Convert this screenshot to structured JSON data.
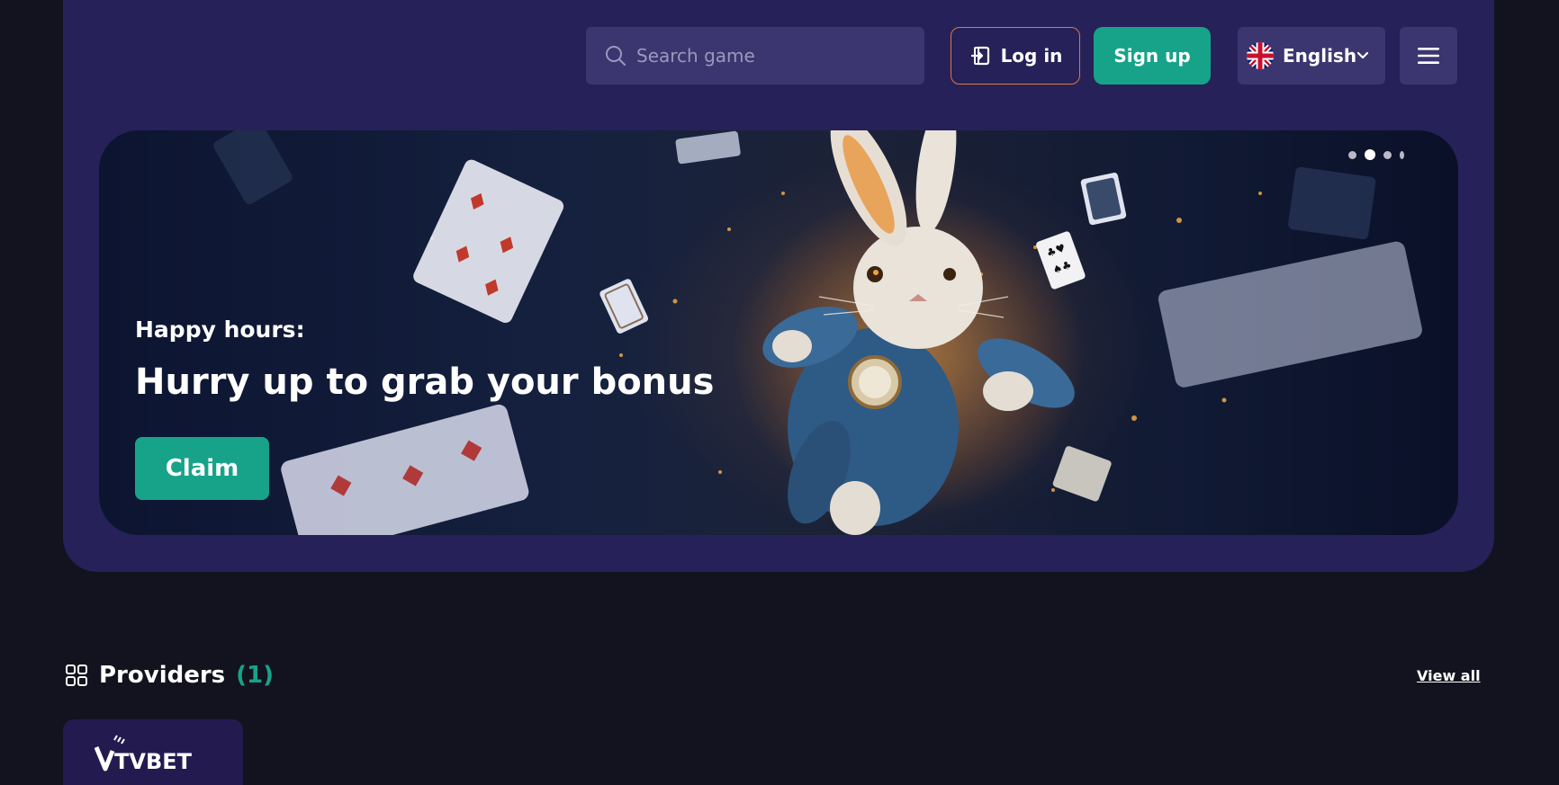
{
  "header": {
    "search": {
      "placeholder": "Search game",
      "value": ""
    },
    "login_label": "Log in",
    "signup_label": "Sign up",
    "language": {
      "selected": "English",
      "flag": "uk-flag-icon"
    }
  },
  "banner": {
    "kicker": "Happy hours:",
    "headline": "Hurry up to grab your bonus",
    "cta_label": "Claim",
    "slides_total": 4,
    "active_slide": 2
  },
  "providers": {
    "title": "Providers",
    "count": "(1)",
    "view_all_label": "View all",
    "items": [
      {
        "name": "TVBET"
      }
    ]
  },
  "colors": {
    "panel": "#262158",
    "accent_green": "#17a389",
    "login_border": "#e0783a",
    "page_bg": "#13121f"
  }
}
